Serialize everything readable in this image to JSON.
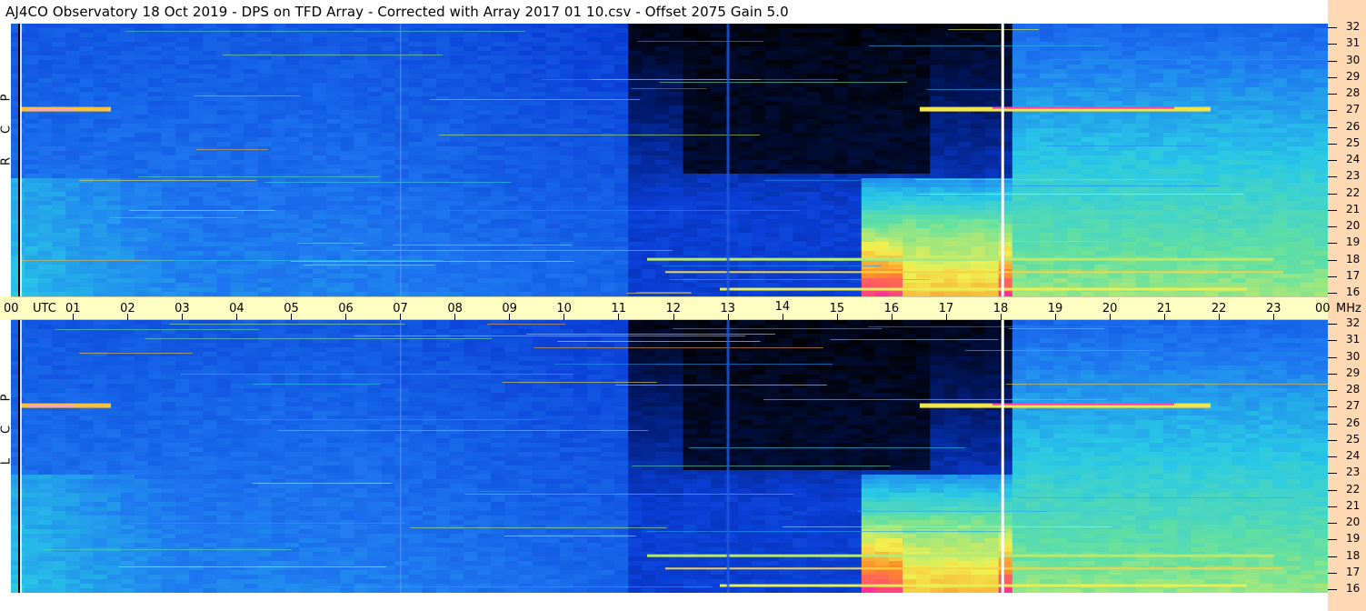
{
  "title": "AJ4CO Observatory  18 Oct 2019  -  DPS on TFD Array  -  Corrected with Array 2017 01 10.csv  -  Offset 2075  Gain 5.0",
  "time_axis": {
    "utc_label": "UTC",
    "mhz_label": "MHz",
    "hours": [
      "00",
      "01",
      "02",
      "03",
      "04",
      "05",
      "06",
      "07",
      "08",
      "09",
      "10",
      "11",
      "12",
      "13",
      "14",
      "15",
      "16",
      "17",
      "18",
      "19",
      "20",
      "21",
      "22",
      "23",
      "00"
    ]
  },
  "freq_labels": [
    "32",
    "31",
    "30",
    "29",
    "28",
    "27",
    "26",
    "25",
    "24",
    "23",
    "22",
    "21",
    "20",
    "19",
    "18",
    "17",
    "16"
  ],
  "panels": [
    {
      "name": "RCP",
      "letters": [
        "P",
        "C",
        "R"
      ]
    },
    {
      "name": "LCP",
      "letters": [
        "P",
        "C",
        "L"
      ]
    }
  ],
  "colors": {
    "title_background": "#ffffff",
    "axis_background": "#ffffc4",
    "side_strip": "#ffd9b3",
    "colormap": [
      "#000000",
      "#001a6e",
      "#0a3fd8",
      "#1e78f0",
      "#28c8e6",
      "#64e0a0",
      "#f0f050",
      "#ff8c28",
      "#ff28a0",
      "#ffffff"
    ]
  },
  "chart_data": {
    "type": "heatmap",
    "title": "AJ4CO Observatory  18 Oct 2019  -  DPS on TFD Array  -  Corrected with Array 2017 01 10.csv  -  Offset 2075  Gain 5.0",
    "xlabel": "UTC",
    "ylabel": "MHz",
    "xlim": [
      0,
      24
    ],
    "ylim": [
      16,
      32
    ],
    "x_ticks": [
      "00",
      "01",
      "02",
      "03",
      "04",
      "05",
      "06",
      "07",
      "08",
      "09",
      "10",
      "11",
      "12",
      "13",
      "14",
      "15",
      "16",
      "17",
      "18",
      "19",
      "20",
      "21",
      "22",
      "23",
      "00"
    ],
    "y_ticks": [
      "16",
      "17",
      "18",
      "19",
      "20",
      "21",
      "22",
      "23",
      "24",
      "25",
      "26",
      "27",
      "28",
      "29",
      "30",
      "31",
      "32"
    ],
    "series": [
      {
        "name": "RCP"
      },
      {
        "name": "LCP"
      }
    ]
  }
}
